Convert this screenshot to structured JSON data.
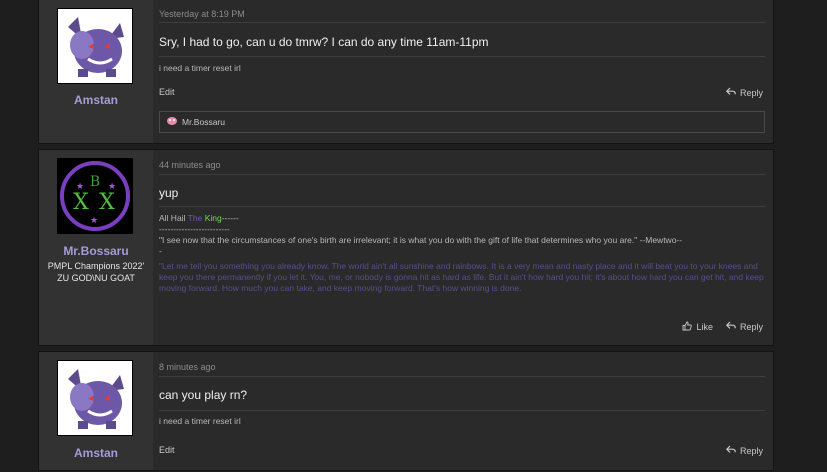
{
  "posts": [
    {
      "username": "Amstan",
      "timestamp": "Yesterday at 8:19 PM",
      "body": "Sry, I had to go, can u do tmrw? I can do any time 11am-11pm",
      "signature": "i need a timer reset irl",
      "edit_label": "Edit",
      "reply_label": "Reply",
      "quote_user": "Mr.Bossaru"
    },
    {
      "username": "Mr.Bossaru",
      "user_title": "PMPL Champions 2022' ZU GOD\\NU GOAT",
      "timestamp": "44 minutes ago",
      "body": "yup",
      "signature": {
        "hail_prefix": "All Hail ",
        "hail_the": "The ",
        "hail_king": "King",
        "hail_suffix": "------",
        "dashes": "-------------------------",
        "quote1": "\"I see now that the circumstances of one's birth are irrelevant; it is what you do with the gift of life that determines who you are.\" --Mewtwo--",
        "quote1_tail": "-",
        "quote2": "\"Let me tell you something you already know. The world ain't all sunshine and rainbows. It is a very mean and nasty place and it will beat you to your knees and keep you there permanently if you let it. You, me, or nobody is gonna hit as hard as life. But it ain't how hard you hit; it's about how hard you can get hit, and keep moving forward. How much you can take, and keep moving forward. That's how winning is done."
      },
      "like_label": "Like",
      "reply_label": "Reply"
    },
    {
      "username": "Amstan",
      "timestamp": "8 minutes ago",
      "body": "can you play rn?",
      "signature": "i need a timer reset irl",
      "edit_label": "Edit",
      "reply_label": "Reply"
    }
  ]
}
